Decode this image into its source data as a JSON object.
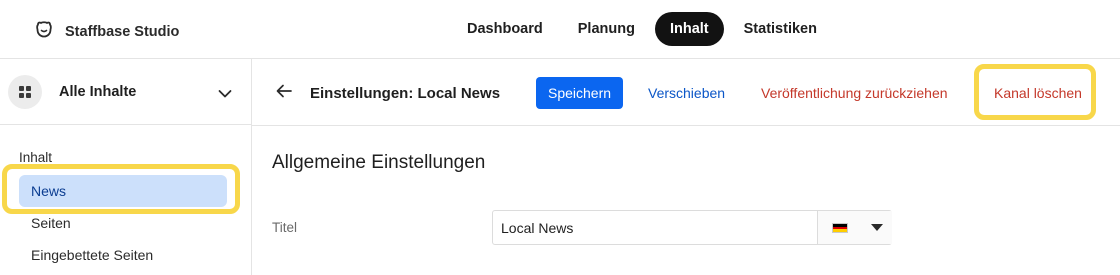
{
  "app": {
    "brand_name": "Staffbase Studio",
    "brand_icon": "staffbase-logo-icon"
  },
  "topnav": {
    "tabs": [
      {
        "label": "Dashboard",
        "active": false
      },
      {
        "label": "Planung",
        "active": false
      },
      {
        "label": "Inhalt",
        "active": true
      },
      {
        "label": "Statistiken",
        "active": false
      }
    ]
  },
  "sidebar": {
    "title": "Alle Inhalte",
    "section_label": "Inhalt",
    "items": [
      {
        "label": "News",
        "active": true
      },
      {
        "label": "Seiten",
        "active": false
      },
      {
        "label": "Eingebettete Seiten",
        "active": false
      }
    ]
  },
  "toolbar": {
    "title": "Einstellungen: Local News",
    "save_label": "Speichern",
    "move_label": "Verschieben",
    "unpublish_label": "Veröffentlichung zurückziehen",
    "delete_label": "Kanal löschen"
  },
  "settings": {
    "section_title": "Allgemeine Einstellungen",
    "title_field": {
      "label": "Titel",
      "value": "Local News",
      "language": "de",
      "language_flag": "german-flag-icon"
    }
  },
  "colors": {
    "accent": "#0b66f0",
    "danger": "#c4382a",
    "link": "#0b56c7",
    "highlight": "#f8d74a",
    "active_item_bg": "#cce0fb"
  }
}
